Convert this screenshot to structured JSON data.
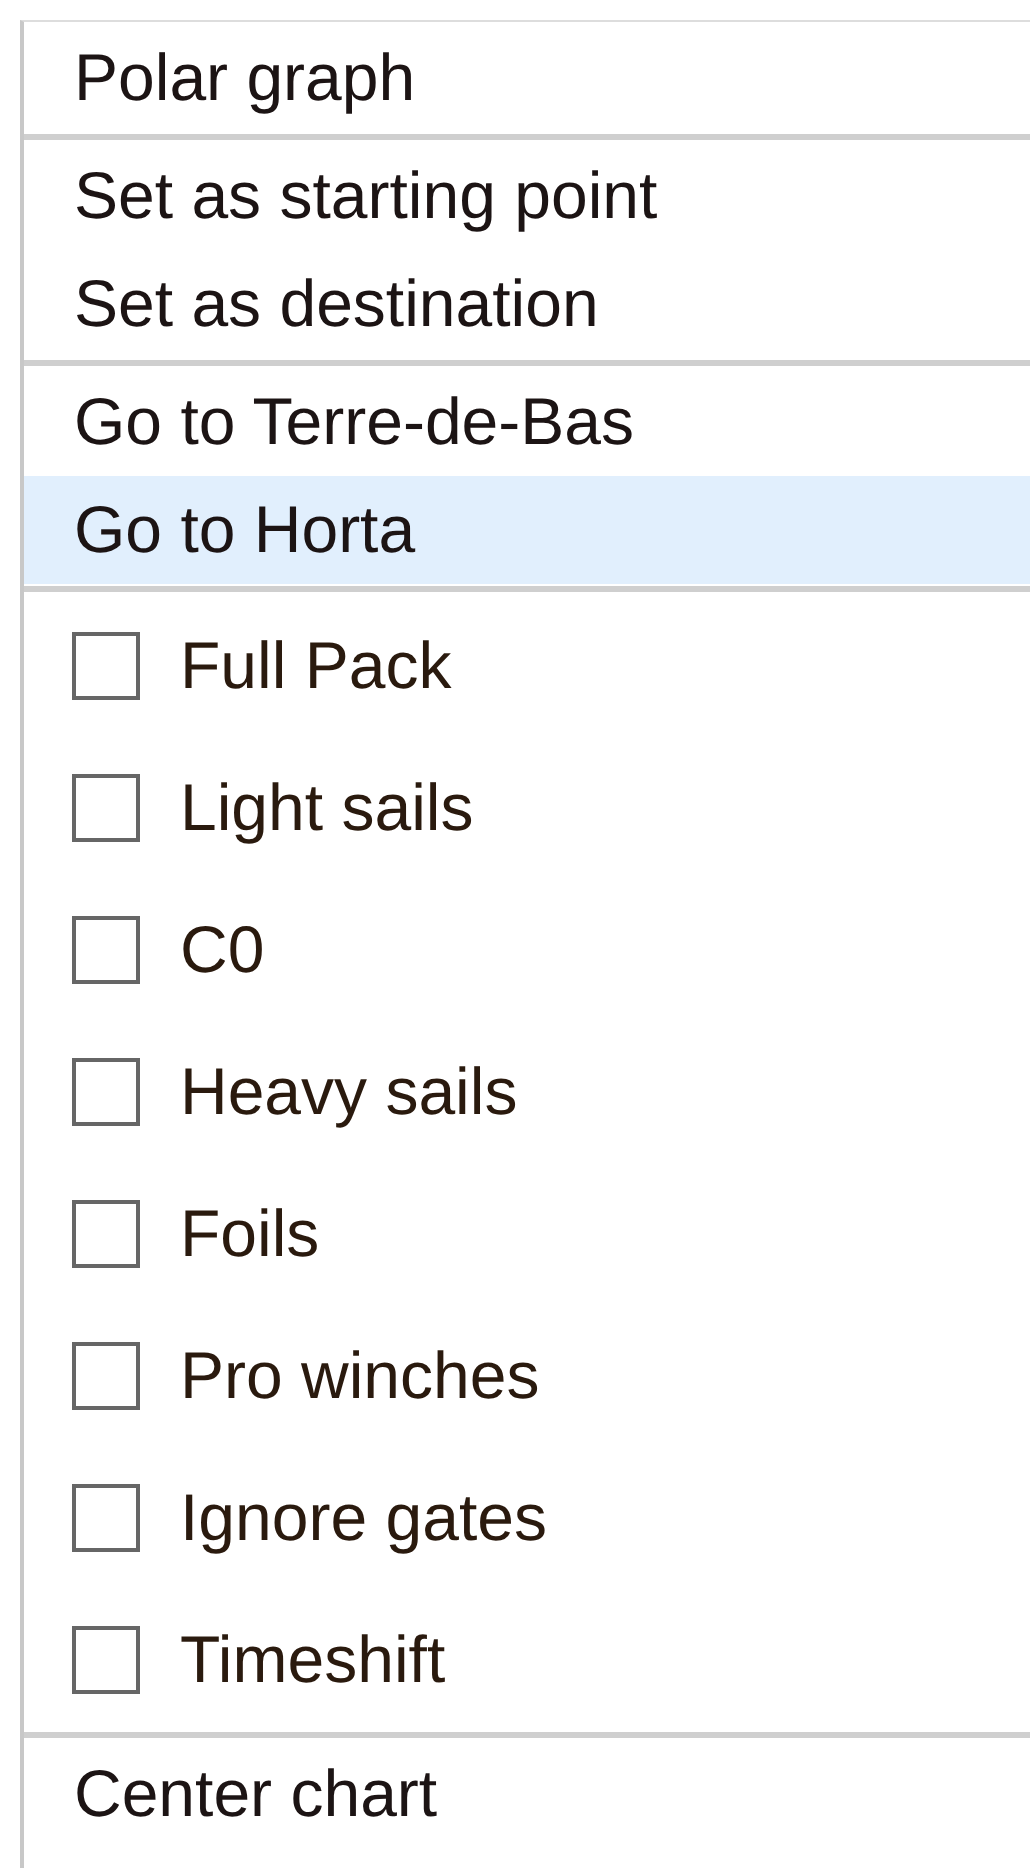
{
  "menu": {
    "groups": [
      {
        "items": [
          {
            "kind": "action",
            "label": "Polar graph",
            "selected": false
          }
        ]
      },
      {
        "items": [
          {
            "kind": "action",
            "label": "Set as starting point",
            "selected": false
          },
          {
            "kind": "action",
            "label": "Set as destination",
            "selected": false
          }
        ]
      },
      {
        "items": [
          {
            "kind": "action",
            "label": "Go to Terre-de-Bas",
            "selected": false
          },
          {
            "kind": "action",
            "label": "Go to Horta",
            "selected": true
          }
        ]
      },
      {
        "items": [
          {
            "kind": "checkbox",
            "label": "Full Pack",
            "checked": false
          },
          {
            "kind": "checkbox",
            "label": "Light sails",
            "checked": false
          },
          {
            "kind": "checkbox",
            "label": "C0",
            "checked": false
          },
          {
            "kind": "checkbox",
            "label": "Heavy sails",
            "checked": false
          },
          {
            "kind": "checkbox",
            "label": "Foils",
            "checked": false
          },
          {
            "kind": "checkbox",
            "label": "Pro winches",
            "checked": false
          },
          {
            "kind": "checkbox",
            "label": "Ignore gates",
            "checked": false
          },
          {
            "kind": "checkbox",
            "label": "Timeshift",
            "checked": false
          }
        ]
      },
      {
        "items": [
          {
            "kind": "action",
            "label": "Center chart",
            "selected": false
          }
        ]
      }
    ]
  }
}
